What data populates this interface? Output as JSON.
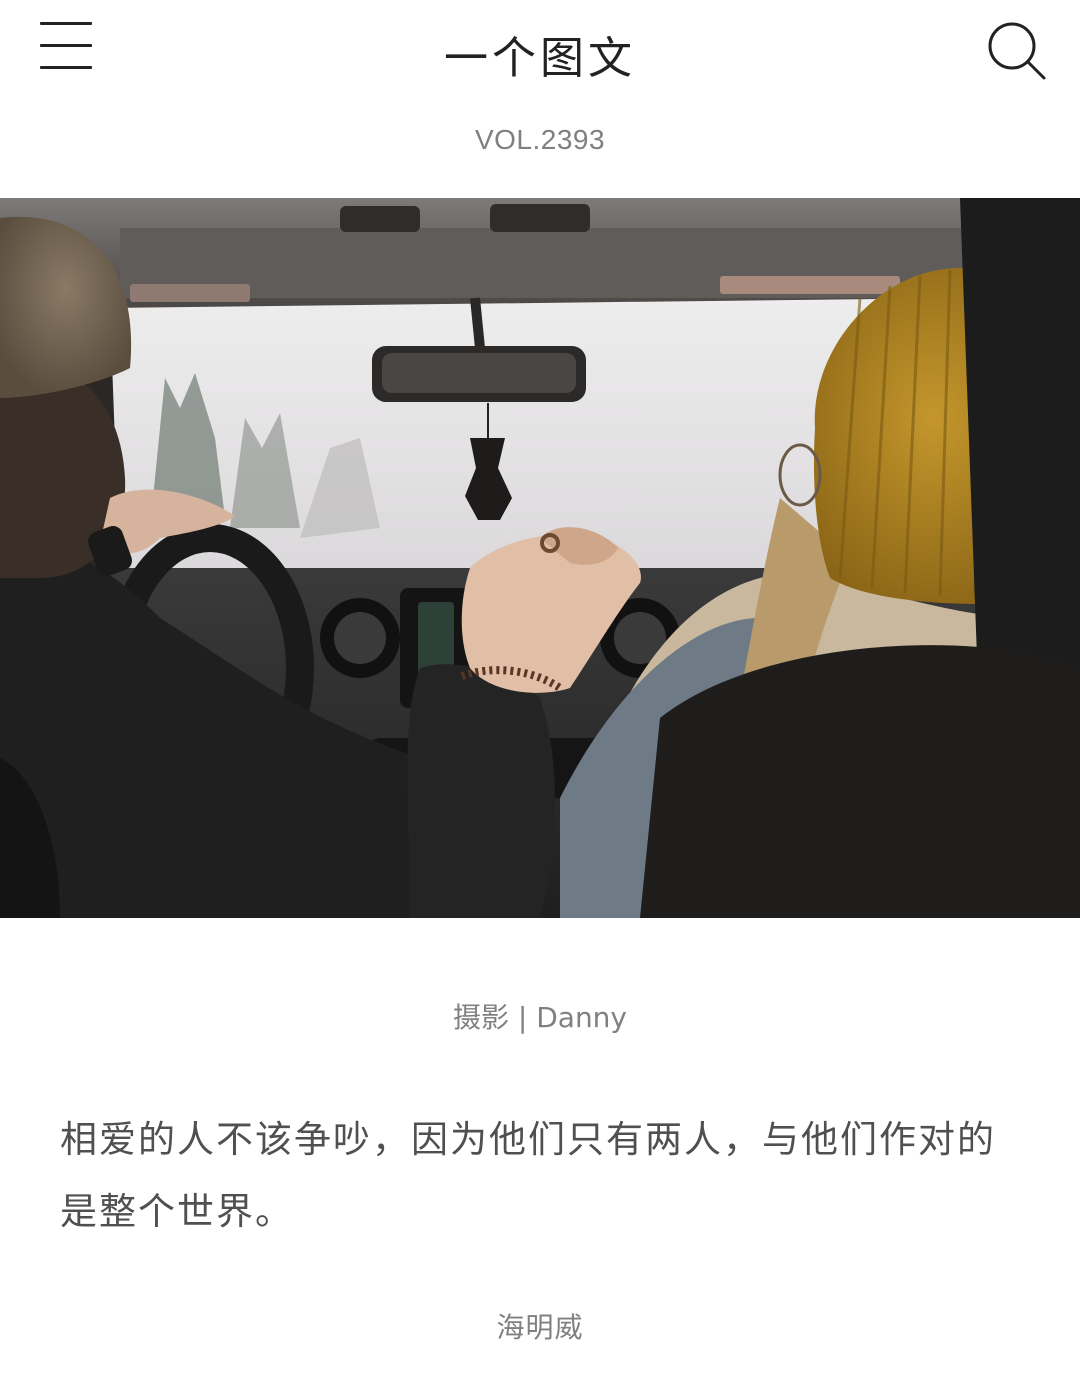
{
  "header": {
    "title": "一个图文",
    "menu_icon": "hamburger-menu-icon",
    "search_icon": "search-icon"
  },
  "volume": "VOL.2393",
  "photo": {
    "description_icon": "photo-couple-in-car-holding-hands"
  },
  "credit": "摄影 | Danny",
  "quote": {
    "text": "相爱的人不该争吵，因为他们只有两人，与他们作对的是整个世界。",
    "author": "海明威"
  },
  "colors": {
    "background": "#ffffff",
    "title_text": "#222222",
    "muted_text": "#808080",
    "body_text": "#505050"
  }
}
